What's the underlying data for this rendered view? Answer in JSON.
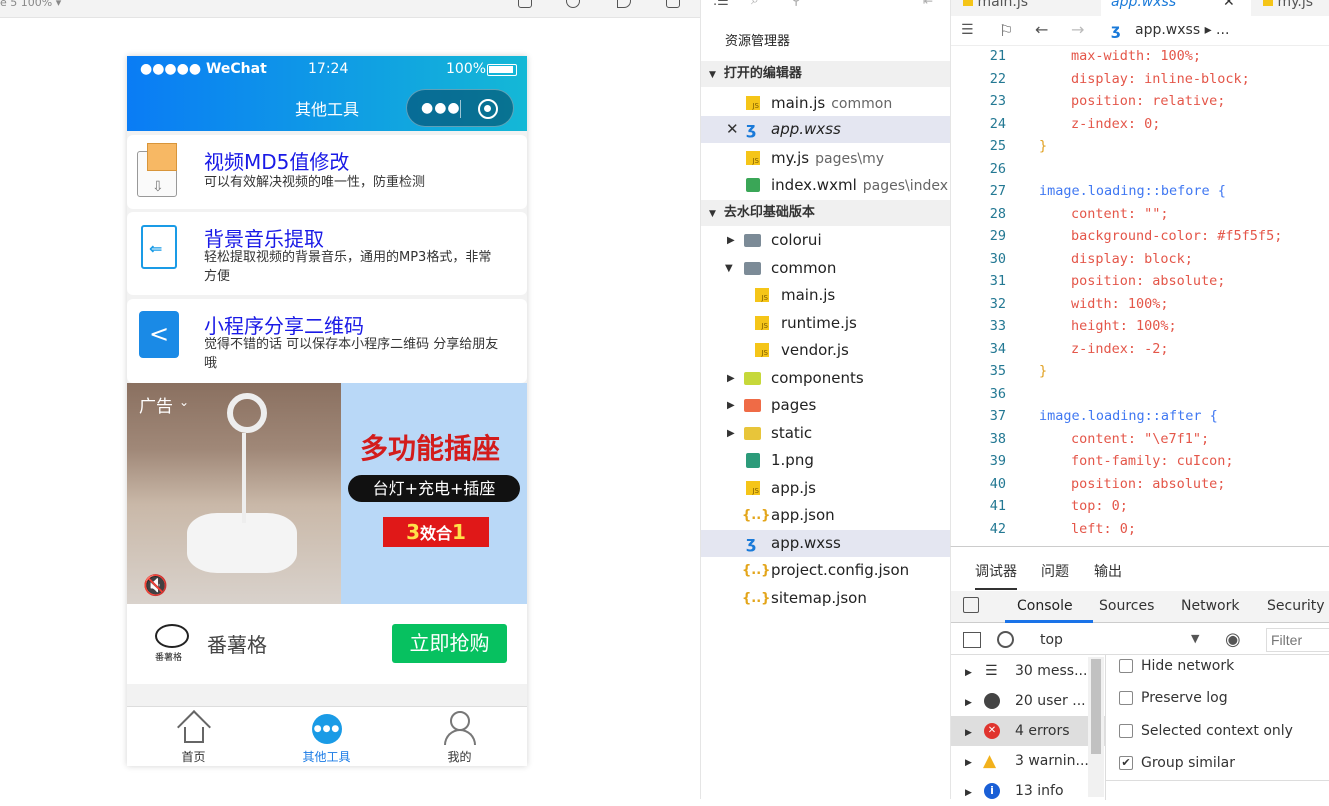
{
  "simulator": {
    "zoom_label": "e 5 100% ▾",
    "status": {
      "carrier": "●●●●● WeChat",
      "time": "17:24",
      "battery": "100%"
    },
    "nav_title": "其他工具",
    "cards": [
      {
        "title": "视频MD5值修改",
        "desc": "可以有效解决视频的唯一性，防重检测"
      },
      {
        "title": "背景音乐提取",
        "desc": "轻松提取视频的背景音乐，通用的MP3格式，非常方便"
      },
      {
        "title": "小程序分享二维码",
        "desc": "觉得不错的话 可以保存本小程序二维码 分享给朋友哦"
      }
    ],
    "ad": {
      "tag": "广告",
      "headline": "多功能插座",
      "subline": "台灯+充电+插座",
      "badge_num1": "3",
      "badge_text": "效合",
      "badge_num2": "1",
      "brand_logo_text": "番薯格",
      "brand_name": "番薯格",
      "buy_label": "立即抢购"
    },
    "tabbar": [
      {
        "label": "首页",
        "icon": "home-icon",
        "active": false
      },
      {
        "label": "其他工具",
        "icon": "more-icon",
        "active": true
      },
      {
        "label": "我的",
        "icon": "user-icon",
        "active": false
      }
    ]
  },
  "explorer": {
    "title": "资源管理器",
    "open_editors_header": "打开的编辑器",
    "open_editors": [
      {
        "name": "main.js",
        "path": "common",
        "type": "js"
      },
      {
        "name": "app.wxss",
        "path": "",
        "type": "css"
      },
      {
        "name": "my.js",
        "path": "pages\\my",
        "type": "js"
      },
      {
        "name": "index.wxml",
        "path": "pages\\index",
        "type": "wxml"
      }
    ],
    "project_header": "去水印基础版本",
    "tree": [
      {
        "name": "colorui",
        "type": "folder"
      },
      {
        "name": "common",
        "type": "folder"
      },
      {
        "name": "main.js",
        "type": "js"
      },
      {
        "name": "runtime.js",
        "type": "js"
      },
      {
        "name": "vendor.js",
        "type": "js"
      },
      {
        "name": "components",
        "type": "folder"
      },
      {
        "name": "pages",
        "type": "folder"
      },
      {
        "name": "static",
        "type": "folder"
      },
      {
        "name": "1.png",
        "type": "img"
      },
      {
        "name": "app.js",
        "type": "js"
      },
      {
        "name": "app.json",
        "type": "json"
      },
      {
        "name": "app.wxss",
        "type": "css"
      },
      {
        "name": "project.config.json",
        "type": "json"
      },
      {
        "name": "sitemap.json",
        "type": "json"
      }
    ]
  },
  "editor": {
    "tabs": [
      "main.js",
      "app.wxss",
      "my.js"
    ],
    "breadcrumb": "app.wxss ▸ ...",
    "lines": [
      {
        "n": "21",
        "text": "max-width: 100%;"
      },
      {
        "n": "22",
        "text": "display: inline-block;"
      },
      {
        "n": "23",
        "text": "position: relative;"
      },
      {
        "n": "24",
        "text": "z-index: 0;"
      },
      {
        "n": "25",
        "text": "}"
      },
      {
        "n": "26",
        "text": ""
      },
      {
        "n": "27",
        "text": "image.loading::before {"
      },
      {
        "n": "28",
        "text": "content: \"\";"
      },
      {
        "n": "29",
        "text": "background-color: #f5f5f5;"
      },
      {
        "n": "30",
        "text": "display: block;"
      },
      {
        "n": "31",
        "text": "position: absolute;"
      },
      {
        "n": "32",
        "text": "width: 100%;"
      },
      {
        "n": "33",
        "text": "height: 100%;"
      },
      {
        "n": "34",
        "text": "z-index: -2;"
      },
      {
        "n": "35",
        "text": "}"
      },
      {
        "n": "36",
        "text": ""
      },
      {
        "n": "37",
        "text": "image.loading::after {"
      },
      {
        "n": "38",
        "text": "content: \"\\e7f1\";"
      },
      {
        "n": "39",
        "text": "font-family: cuIcon;"
      },
      {
        "n": "40",
        "text": "position: absolute;"
      },
      {
        "n": "41",
        "text": "top: 0;"
      },
      {
        "n": "42",
        "text": "left: 0;"
      }
    ]
  },
  "devtools": {
    "top_tabs": [
      "调试器",
      "问题",
      "输出"
    ],
    "tabs": [
      "Console",
      "Sources",
      "Network",
      "Security"
    ],
    "context": "top",
    "filter_placeholder": "Filter",
    "messages": [
      {
        "label": "30 mess...",
        "icon": "list-icon"
      },
      {
        "label": "20 user ...",
        "icon": "user-circle-icon"
      },
      {
        "label": "4 errors",
        "icon": "error-icon"
      },
      {
        "label": "3 warnin...",
        "icon": "warning-icon"
      },
      {
        "label": "13 info",
        "icon": "info-icon"
      }
    ],
    "options": [
      {
        "label": "Hide network",
        "checked": false
      },
      {
        "label": "Preserve log",
        "checked": false
      },
      {
        "label": "Selected context only",
        "checked": false
      },
      {
        "label": "Group similar",
        "checked": true
      }
    ]
  }
}
